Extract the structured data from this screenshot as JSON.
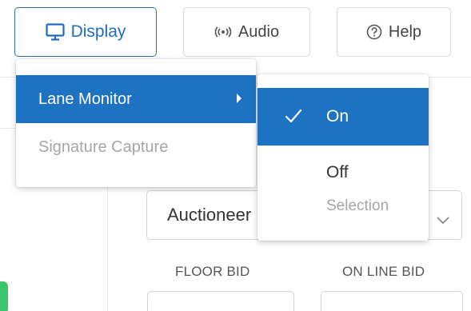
{
  "toolbar": {
    "display_label": "Display",
    "audio_label": "Audio",
    "help_label": "Help",
    "accent_color": "#1e72c2"
  },
  "display_menu": {
    "items": [
      {
        "label": "Lane Monitor",
        "highlighted": true,
        "has_submenu": true,
        "disabled": false
      },
      {
        "label": "Signature Capture",
        "highlighted": false,
        "has_submenu": false,
        "disabled": true
      }
    ]
  },
  "lane_monitor_submenu": {
    "items": [
      {
        "label": "On",
        "checked": true,
        "highlighted": true
      },
      {
        "label": "Off",
        "checked": false,
        "highlighted": false
      },
      {
        "label": "Selection",
        "checked": false,
        "highlighted": false,
        "disabled": true
      }
    ]
  },
  "main": {
    "auctioneer_select_text": "Auctioneer",
    "floor_bid_label": "FLOOR BID",
    "online_bid_label": "ON LINE BID"
  },
  "icons": {
    "display": "monitor-icon",
    "audio": "broadcast-icon",
    "help": "question-circle-icon",
    "check": "checkmark-icon",
    "caret": "chevron-down-icon",
    "submenu": "caret-right-icon"
  }
}
